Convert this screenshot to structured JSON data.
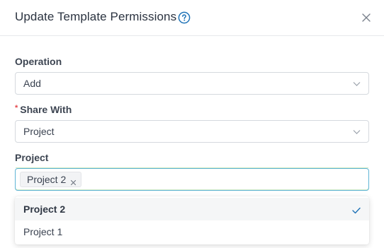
{
  "dialog": {
    "title": "Update Template Permissions"
  },
  "fields": {
    "operation": {
      "label": "Operation",
      "value": "Add"
    },
    "share_with": {
      "label": "Share With",
      "required_mark": "*",
      "value": "Project"
    },
    "project": {
      "label": "Project",
      "tags": [
        "Project 2"
      ]
    }
  },
  "dropdown": {
    "options": [
      {
        "label": "Project 2",
        "selected": true
      },
      {
        "label": "Project 1",
        "selected": false
      }
    ]
  },
  "icons": {
    "help": "help-circle-icon",
    "close": "close-icon",
    "chevron": "chevron-down-icon",
    "tag_remove": "tag-remove-icon",
    "check": "check-icon"
  },
  "colors": {
    "accent": "#1f73b7",
    "focus_border": "#5fb4d6",
    "required": "#e5484d"
  }
}
